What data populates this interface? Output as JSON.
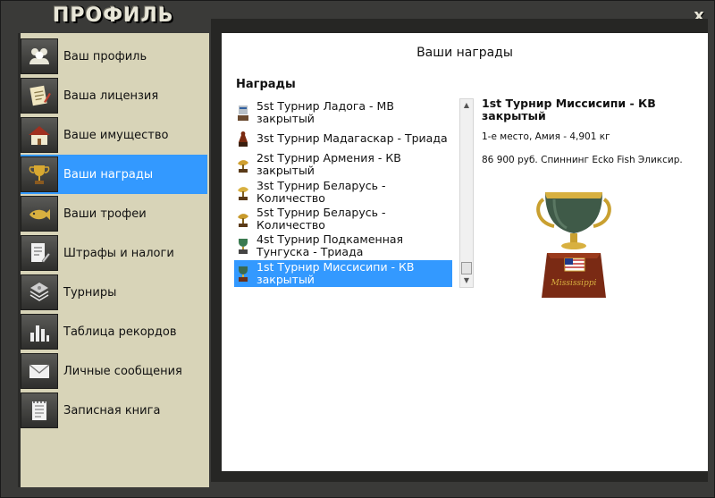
{
  "window": {
    "title": "ПРОФИЛЬ",
    "close_label": "x"
  },
  "sidebar": {
    "items": [
      {
        "label": "Ваш профиль",
        "icon": "users-icon"
      },
      {
        "label": "Ваша лицензия",
        "icon": "license-icon"
      },
      {
        "label": "Ваше имущество",
        "icon": "house-icon"
      },
      {
        "label": "Ваши награды",
        "icon": "trophy-icon",
        "active": true
      },
      {
        "label": "Ваши трофеи",
        "icon": "fish-icon"
      },
      {
        "label": "Штрафы и налоги",
        "icon": "document-pen-icon"
      },
      {
        "label": "Турниры",
        "icon": "tournament-icon"
      },
      {
        "label": "Таблица рекордов",
        "icon": "bar-chart-icon"
      },
      {
        "label": "Личные сообщения",
        "icon": "envelope-icon"
      },
      {
        "label": "Записная книга",
        "icon": "notebook-icon"
      }
    ]
  },
  "main": {
    "title": "Ваши награды",
    "section_heading": "Награды",
    "awards": [
      {
        "label": "5st Турнир Ладога - МВ закрытый"
      },
      {
        "label": "3st Турнир Мадагаскар - Триада"
      },
      {
        "label": "2st Турнир Армения - КВ закрытый"
      },
      {
        "label": "3st Турнир Беларусь - Количество"
      },
      {
        "label": "5st Турнир Беларусь - Количество"
      },
      {
        "label": "4st Турнир Подкаменная Тунгуска - Триада"
      },
      {
        "label": "1st Турнир Миссисипи - КВ закрытый",
        "selected": true
      }
    ],
    "detail": {
      "title": "1st Турнир Миссисипи - КВ закрытый",
      "place_line": "1-е место, Амия - 4,901 кг",
      "prize_line": "86 900 руб. Спиннинг Ecko Fish Эликсир.",
      "trophy_plate_text": "Mississippi"
    }
  },
  "colors": {
    "accent": "#3399ff",
    "sidebar_bg": "#d8d4b8",
    "frame": "#323232"
  }
}
